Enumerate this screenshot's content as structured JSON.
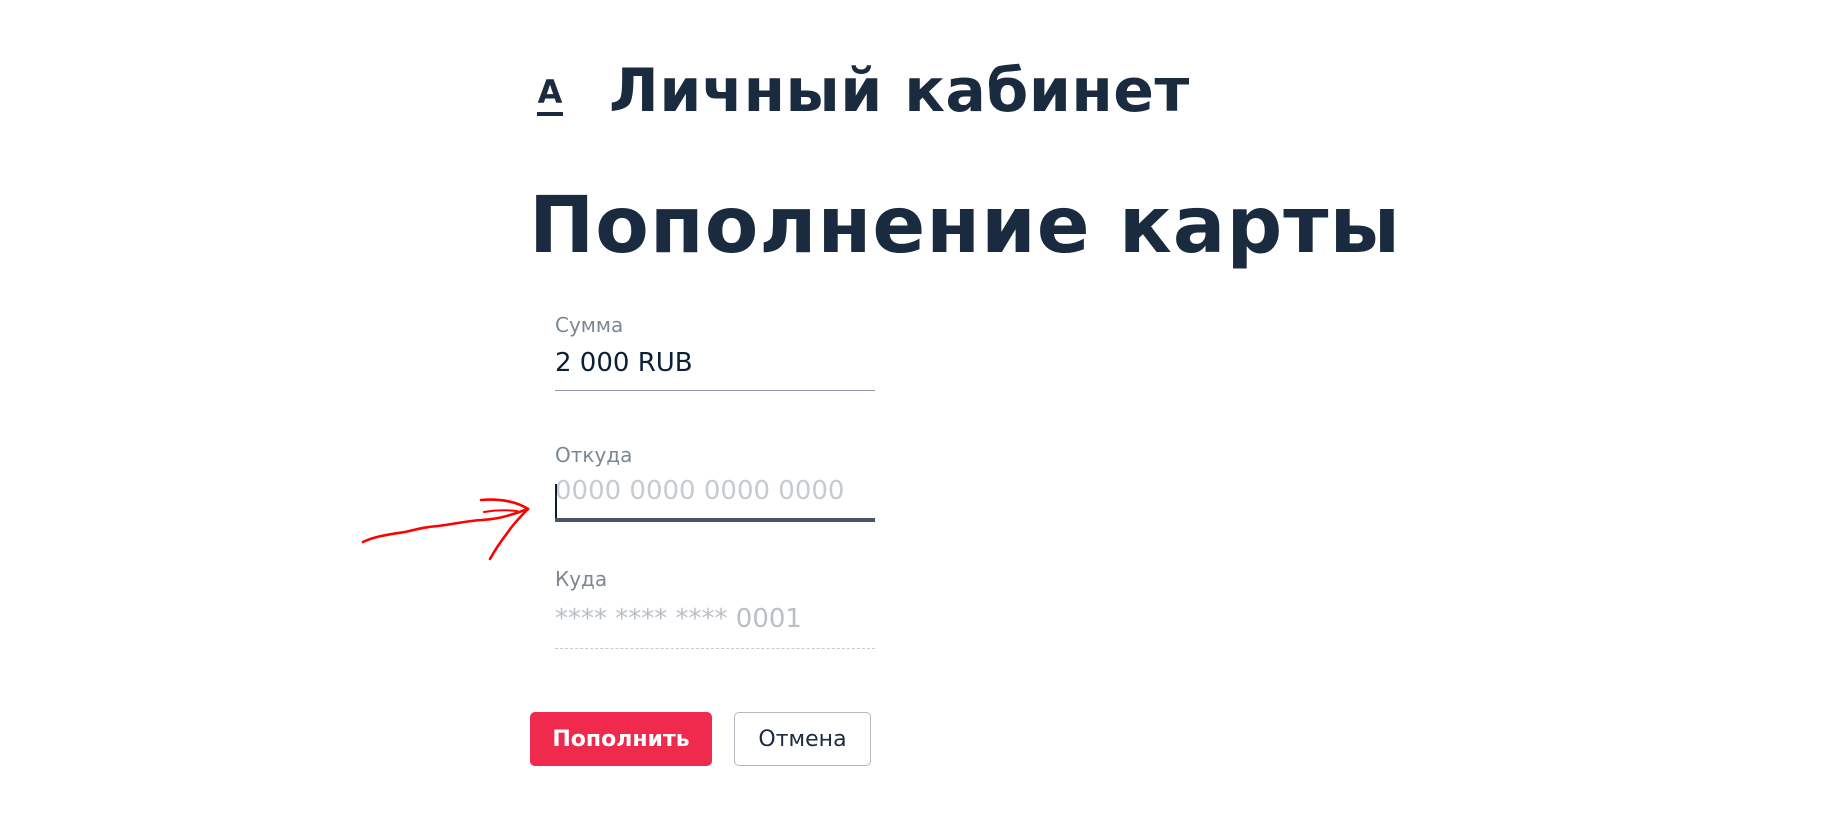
{
  "header": {
    "logo_letter": "А",
    "app_title": "Личный кабинет"
  },
  "page": {
    "title": "Пополнение карты"
  },
  "form": {
    "amount": {
      "label": "Сумма",
      "value": "2 000 RUB"
    },
    "from": {
      "label": "Откуда",
      "value": "",
      "placeholder": "0000 0000 0000 0000"
    },
    "to": {
      "label": "Куда",
      "value": "**** **** **** 0001"
    }
  },
  "actions": {
    "submit_label": "Пополнить",
    "cancel_label": "Отмена"
  },
  "colors": {
    "text_primary": "#1a2a3f",
    "label_gray": "#7b8794",
    "accent_red": "#ef2a4d",
    "annotation_red": "#ff0000"
  },
  "annotation": {
    "icon": "hand-drawn-arrow-icon"
  }
}
